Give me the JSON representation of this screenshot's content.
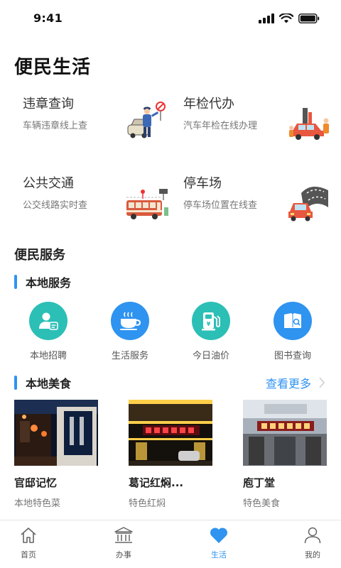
{
  "status_bar": {
    "time": "9:41"
  },
  "page": {
    "title": "便民生活"
  },
  "features": [
    {
      "title": "违章查询",
      "subtitle": "车辆违章线上查",
      "icon": "traffic-police-illustration"
    },
    {
      "title": "年检代办",
      "subtitle": "汽车年检在线办理",
      "icon": "car-inspection-illustration"
    },
    {
      "title": "公共交通",
      "subtitle": "公交线路实时查",
      "icon": "bus-illustration"
    },
    {
      "title": "停车场",
      "subtitle": "停车场位置在线查",
      "icon": "parking-illustration"
    }
  ],
  "services": {
    "section_title": "便民服务",
    "local_title": "本地服务",
    "items": [
      {
        "label": "本地招聘",
        "icon": "recruit-icon",
        "color": "#2bbfb6"
      },
      {
        "label": "生活服务",
        "icon": "coffee-cup-icon",
        "color": "#2f93f0"
      },
      {
        "label": "今日油价",
        "icon": "fuel-pump-icon",
        "color": "#2bbfb6"
      },
      {
        "label": "图书查询",
        "icon": "book-search-icon",
        "color": "#2f93f0"
      }
    ]
  },
  "food": {
    "title": "本地美食",
    "more_label": "查看更多",
    "items": [
      {
        "name": "官邸记忆",
        "desc": "本地特色菜"
      },
      {
        "name": "葛记红焖...",
        "desc": "特色红焖"
      },
      {
        "name": "庖丁堂",
        "desc": "特色美食"
      }
    ]
  },
  "tabs": [
    {
      "label": "首页",
      "icon": "home-icon",
      "active": false
    },
    {
      "label": "办事",
      "icon": "government-building-icon",
      "active": false
    },
    {
      "label": "生活",
      "icon": "heart-icon",
      "active": true
    },
    {
      "label": "我的",
      "icon": "user-icon",
      "active": false
    }
  ],
  "colors": {
    "accent": "#2f93f0",
    "teal": "#2bbfb6"
  }
}
